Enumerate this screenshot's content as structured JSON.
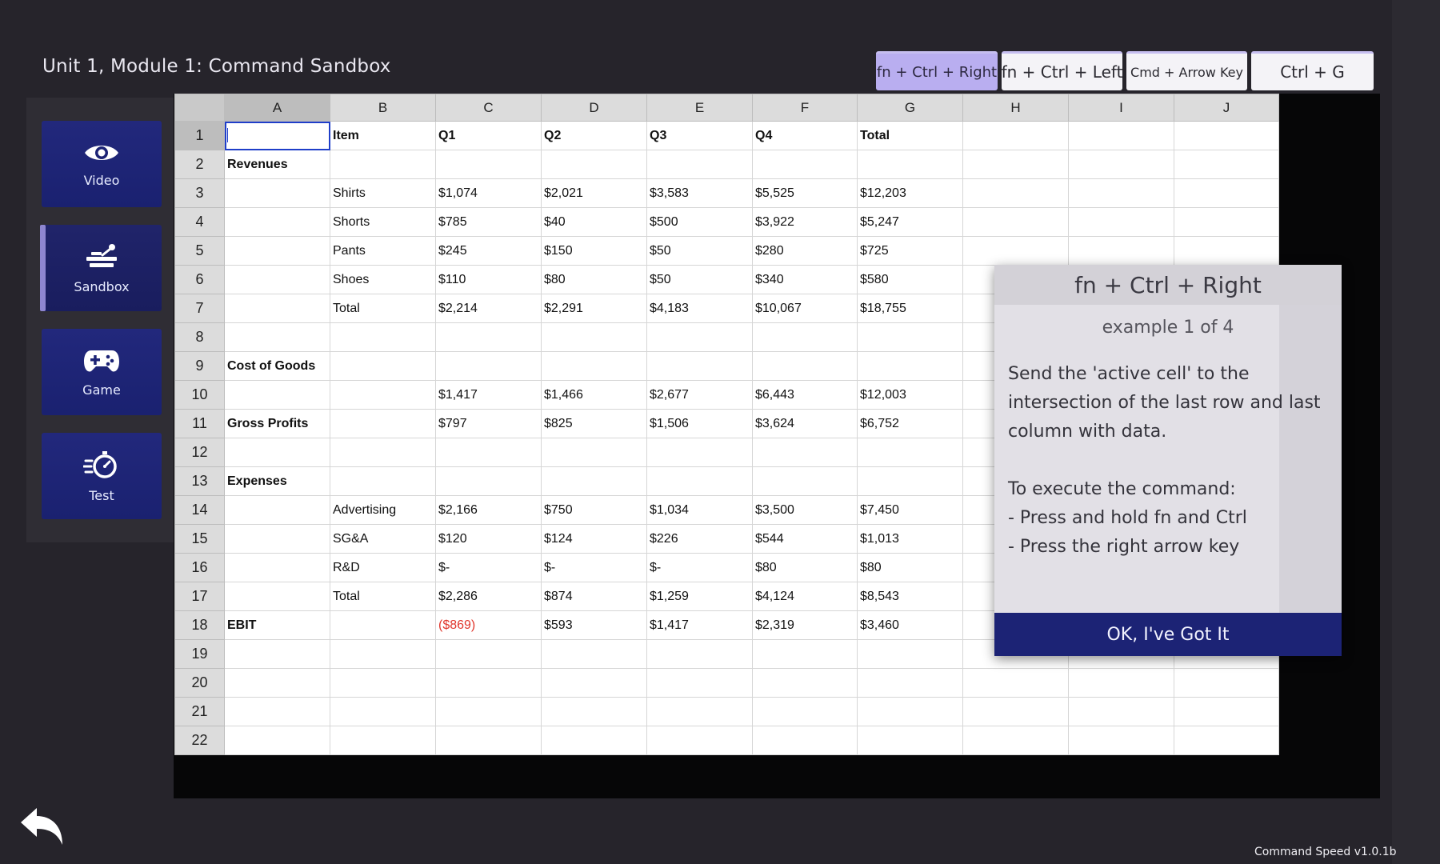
{
  "page": {
    "title": "Unit 1, Module 1: Command Sandbox",
    "version": "Command Speed v1.0.1b"
  },
  "command_tabs": [
    {
      "label": "fn + Ctrl + Right",
      "active": true
    },
    {
      "label": "fn + Ctrl + Left",
      "active": false
    },
    {
      "label": "Cmd + Arrow Key",
      "active": false
    },
    {
      "label": "Ctrl + G",
      "active": false
    }
  ],
  "sidebar": {
    "items": [
      {
        "label": "Video",
        "icon": "eye-icon"
      },
      {
        "label": "Sandbox",
        "icon": "sandbox-icon",
        "active": true
      },
      {
        "label": "Game",
        "icon": "gamepad-icon"
      },
      {
        "label": "Test",
        "icon": "stopwatch-icon"
      }
    ]
  },
  "sheet": {
    "columns": [
      "A",
      "B",
      "C",
      "D",
      "E",
      "F",
      "G",
      "H",
      "I",
      "J"
    ],
    "active_cell": "A1",
    "rows": [
      [
        "",
        "Item",
        "Q1",
        "Q2",
        "Q3",
        "Q4",
        "Total",
        "",
        "",
        ""
      ],
      [
        "Revenues",
        "",
        "",
        "",
        "",
        "",
        "",
        "",
        "",
        ""
      ],
      [
        "",
        "Shirts",
        "$1,074",
        "$2,021",
        "$3,583",
        "$5,525",
        "$12,203",
        "",
        "",
        ""
      ],
      [
        "",
        "Shorts",
        "$785",
        "$40",
        "$500",
        "$3,922",
        "$5,247",
        "",
        "",
        ""
      ],
      [
        "",
        "Pants",
        "$245",
        "$150",
        "$50",
        "$280",
        "$725",
        "",
        "",
        ""
      ],
      [
        "",
        "Shoes",
        "$110",
        "$80",
        "$50",
        "$340",
        "$580",
        "",
        "",
        ""
      ],
      [
        "",
        "Total",
        "$2,214",
        "$2,291",
        "$4,183",
        "$10,067",
        "$18,755",
        "",
        "",
        ""
      ],
      [
        "",
        "",
        "",
        "",
        "",
        "",
        "",
        "",
        "",
        ""
      ],
      [
        "Cost of Goods",
        "",
        "",
        "",
        "",
        "",
        "",
        "",
        "",
        ""
      ],
      [
        "",
        "",
        "$1,417",
        "$1,466",
        "$2,677",
        "$6,443",
        "$12,003",
        "",
        "",
        ""
      ],
      [
        "Gross Profits",
        "",
        "$797",
        "$825",
        "$1,506",
        "$3,624",
        "$6,752",
        "",
        "",
        ""
      ],
      [
        "",
        "",
        "",
        "",
        "",
        "",
        "",
        "",
        "",
        ""
      ],
      [
        "Expenses",
        "",
        "",
        "",
        "",
        "",
        "",
        "",
        "",
        ""
      ],
      [
        "",
        "Advertising",
        "$2,166",
        "$750",
        "$1,034",
        "$3,500",
        "$7,450",
        "",
        "",
        ""
      ],
      [
        "",
        "SG&A",
        "$120",
        "$124",
        "$226",
        "$544",
        "$1,013",
        "",
        "",
        ""
      ],
      [
        "",
        "R&D",
        "$-",
        "$-",
        "$-",
        "$80",
        "$80",
        "",
        "",
        ""
      ],
      [
        "",
        "Total",
        "$2,286",
        "$874",
        "$1,259",
        "$4,124",
        "$8,543",
        "",
        "",
        ""
      ],
      [
        "EBIT",
        "",
        "($869)",
        "$593",
        "$1,417",
        "$2,319",
        "$3,460",
        "",
        "",
        ""
      ],
      [
        "",
        "",
        "",
        "",
        "",
        "",
        "",
        "",
        "",
        ""
      ],
      [
        "",
        "",
        "",
        "",
        "",
        "",
        "",
        "",
        "",
        ""
      ],
      [
        "",
        "",
        "",
        "",
        "",
        "",
        "",
        "",
        "",
        ""
      ],
      [
        "",
        "",
        "",
        "",
        "",
        "",
        "",
        "",
        "",
        ""
      ]
    ],
    "bold_cells": [
      "1-B",
      "1-C",
      "1-D",
      "1-E",
      "1-F",
      "1-G",
      "2-A",
      "9-A",
      "11-A",
      "13-A",
      "18-A"
    ],
    "negative_cells": [
      "18-C"
    ],
    "negative_color": "#e0362c"
  },
  "panel": {
    "title": "fn + Ctrl + Right",
    "subtitle": "example 1 of 4",
    "description": "Send the 'active cell' to the intersection of the last row and last column with data.",
    "instructions_heading": "To execute the command:",
    "steps": [
      "- Press and hold fn and Ctrl",
      "- Press the right arrow key"
    ],
    "button_label": "OK, I've Got It"
  },
  "colors": {
    "nav_blue": "#1c2375",
    "tab_active": "#b9aef0",
    "active_cell_border": "#1f3ec9"
  }
}
